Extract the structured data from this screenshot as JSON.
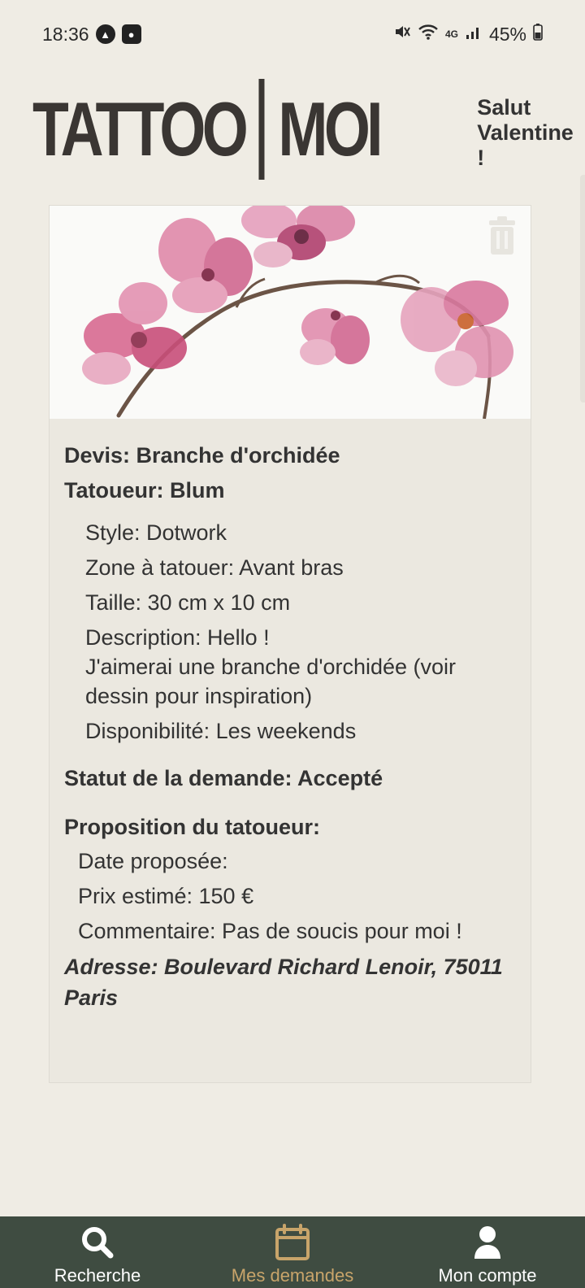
{
  "status_bar": {
    "time": "18:36",
    "battery": "45%",
    "network": "4G",
    "left_icons": [
      "a-circle-icon",
      "record-icon"
    ],
    "right_icons": [
      "mute-icon",
      "wifi-icon",
      "signal-icon",
      "battery-icon"
    ]
  },
  "header": {
    "logo_left": "TATTOO",
    "logo_right": "MOI",
    "greeting": "Salut Valentine !"
  },
  "card": {
    "image_alt": "orchid branch illustration",
    "delete_icon": "trash-icon",
    "devis": "Devis: Branche d'orchidée",
    "tatoueur": "Tatoueur: Blum",
    "style": "Style: Dotwork",
    "zone": "Zone à tatouer: Avant bras",
    "taille": "Taille: 30 cm x 10 cm",
    "description_label": "Description: Hello !",
    "description_text": "J'aimerai une branche d'orchidée (voir dessin pour inspiration)",
    "disponibilite": "Disponibilité: Les weekends",
    "statut": "Statut de la demande: Accepté",
    "proposition_title": "Proposition du tatoueur:",
    "date_proposee": "Date proposée:",
    "prix": "Prix estimé: 150 €",
    "commentaire": "Commentaire: Pas de soucis pour moi !",
    "adresse": "Adresse: Boulevard Richard Lenoir, 75011 Paris"
  },
  "nav": {
    "items": [
      {
        "label": "Recherche",
        "icon": "search-icon",
        "active": false
      },
      {
        "label": "Mes demandes",
        "icon": "calendar-icon",
        "active": true
      },
      {
        "label": "Mon compte",
        "icon": "user-icon",
        "active": false
      }
    ],
    "active_color": "#c8a46a",
    "bg_color": "#3f4c41"
  }
}
